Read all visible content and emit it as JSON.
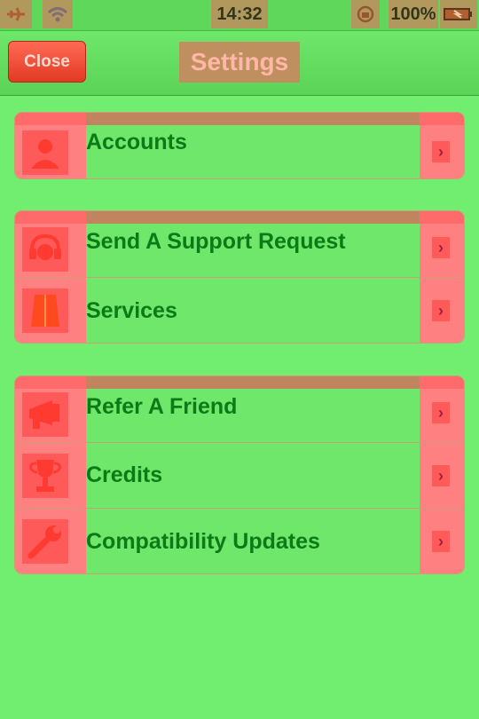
{
  "status_bar": {
    "airplane_icon": "airplane-icon",
    "wifi_icon": "wifi-icon",
    "time": "14:32",
    "rotation_lock_icon": "rotation-lock-icon",
    "battery_percent": "100%",
    "battery_icon": "battery-charging-icon"
  },
  "nav": {
    "close_label": "Close",
    "title": "Settings"
  },
  "groups": [
    {
      "items": [
        {
          "label": "Accounts",
          "icon": "person-icon"
        }
      ]
    },
    {
      "items": [
        {
          "label": "Send A Support Request",
          "icon": "support-icon"
        },
        {
          "label": "Services",
          "icon": "services-icon"
        }
      ]
    },
    {
      "items": [
        {
          "label": "Refer A Friend",
          "icon": "megaphone-icon"
        },
        {
          "label": "Credits",
          "icon": "trophy-icon"
        },
        {
          "label": "Compatibility Updates",
          "icon": "wrench-icon"
        }
      ]
    }
  ],
  "colors": {
    "background": "#71ee6f",
    "label_text": "#0c7a16",
    "highlight_red": "#ff8080",
    "close_button": "#e23a24"
  }
}
